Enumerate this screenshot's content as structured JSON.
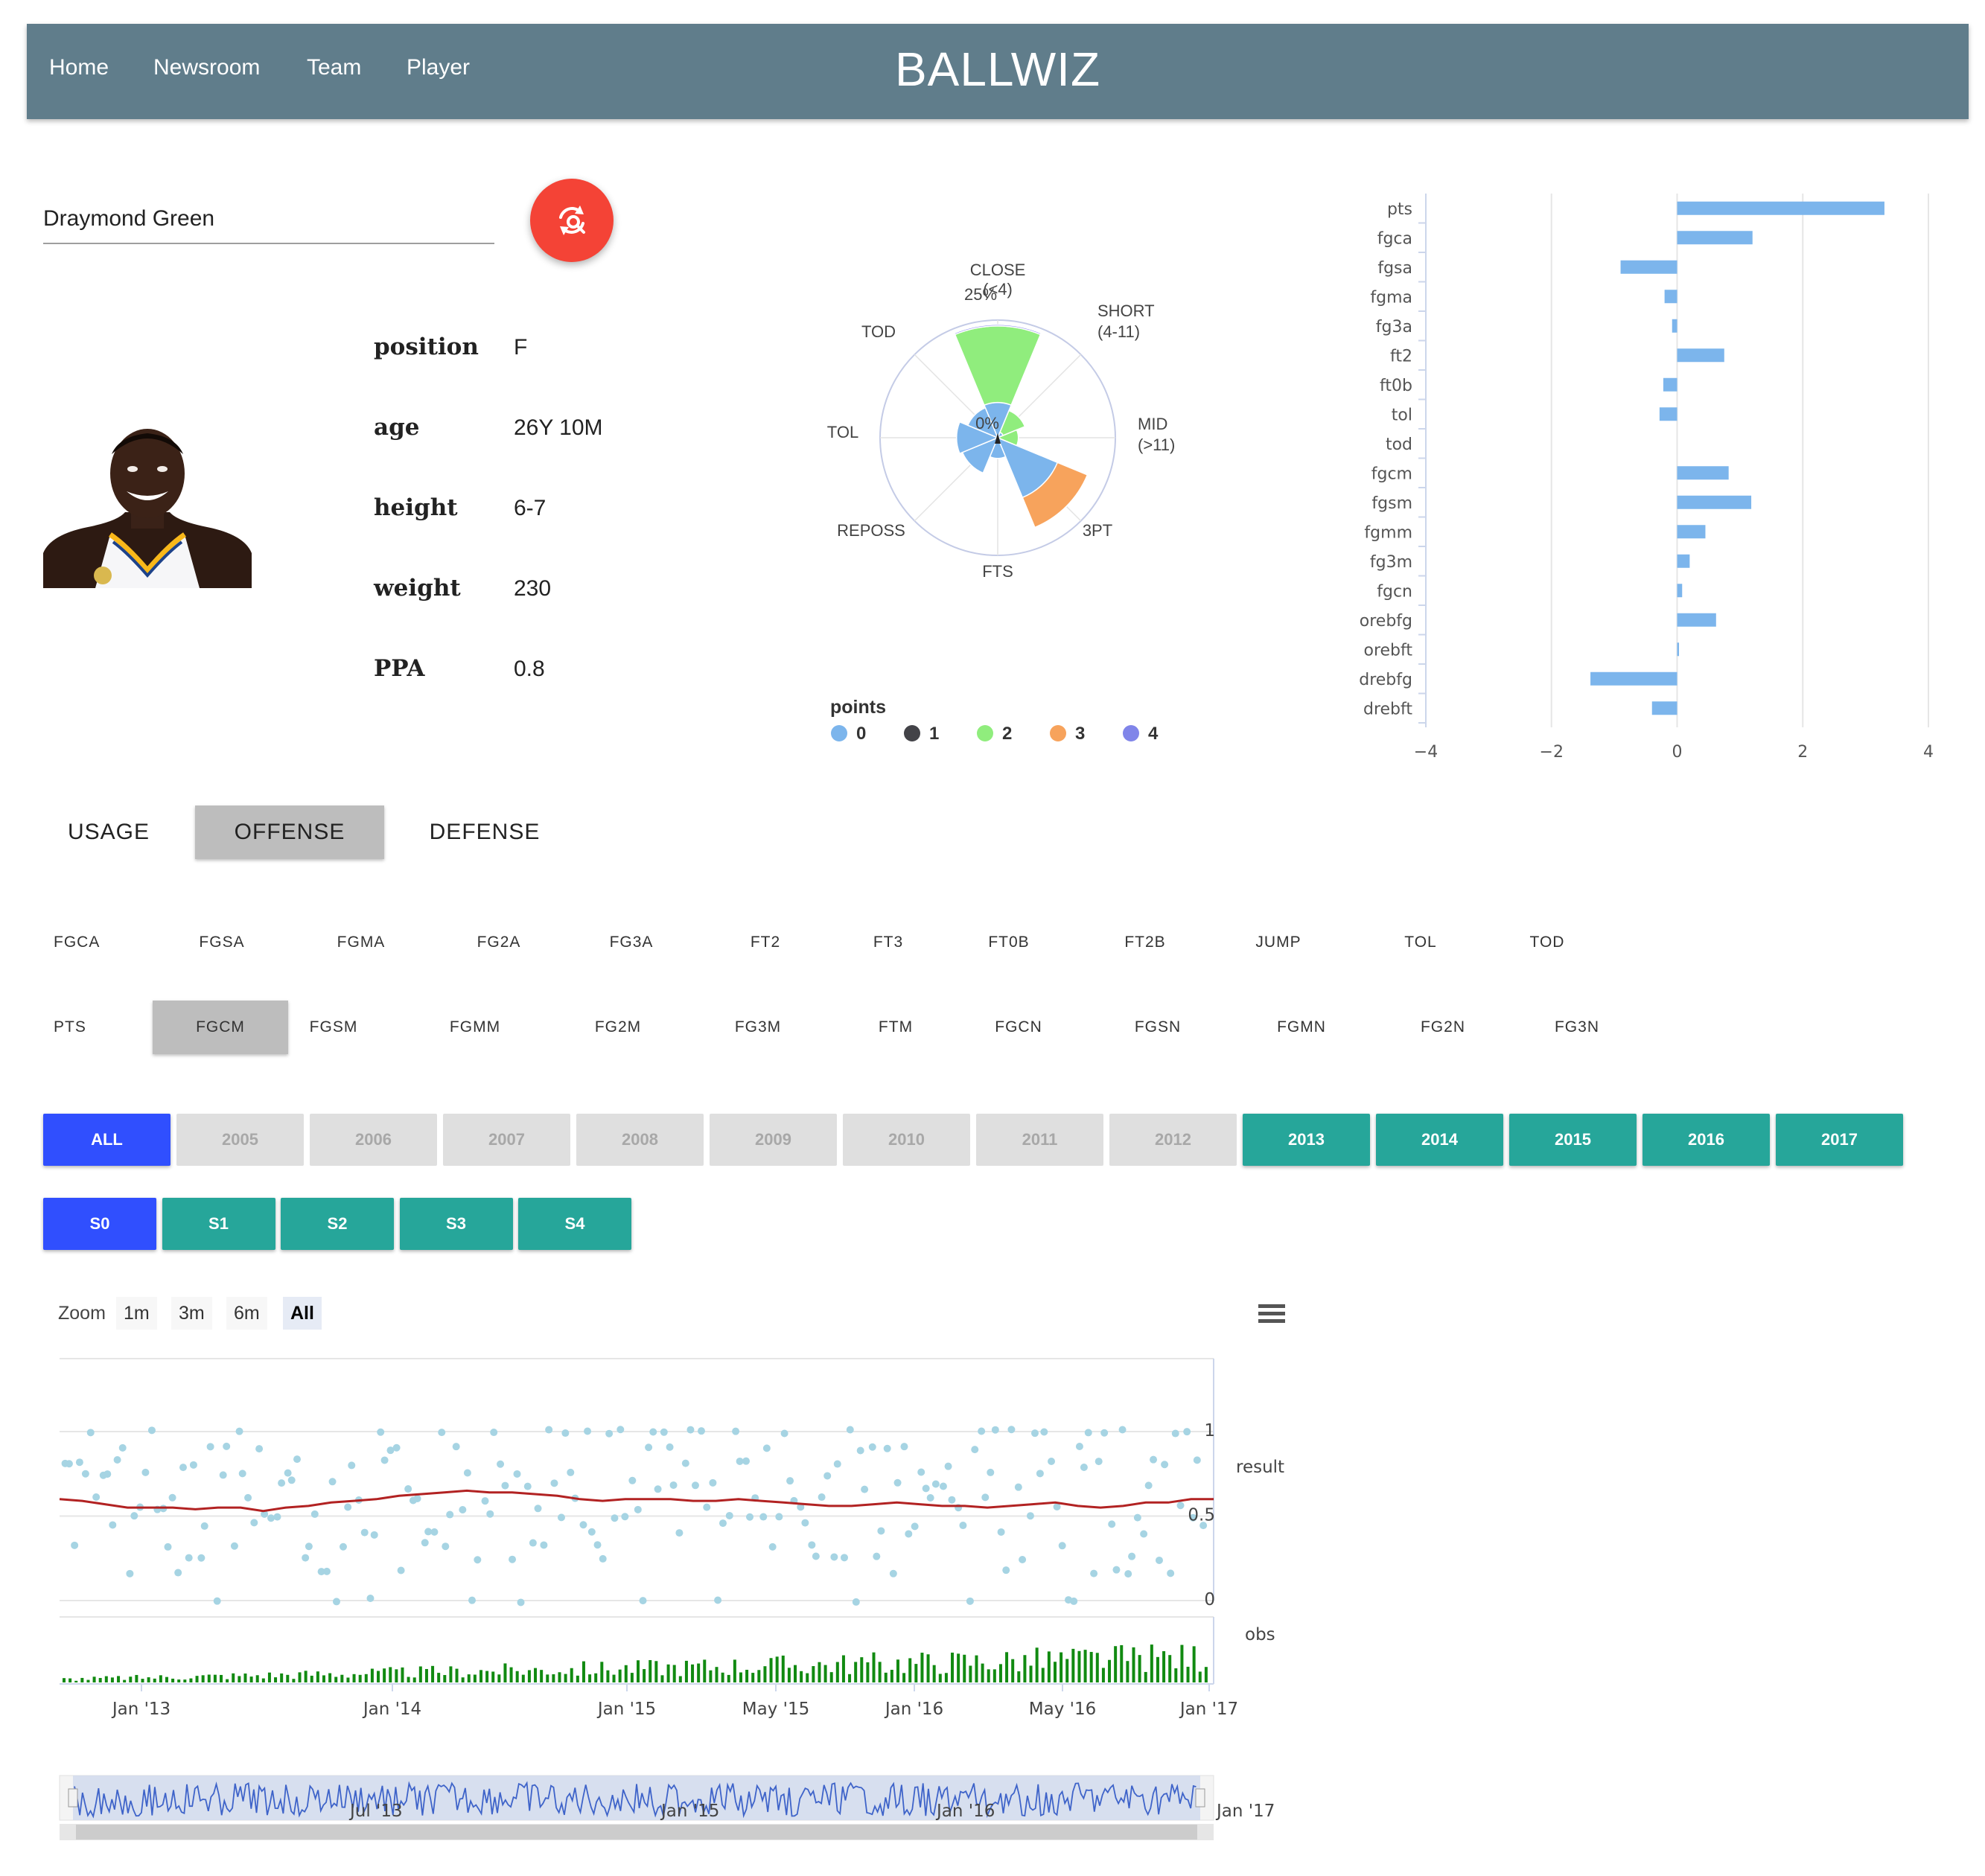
{
  "nav": {
    "brand": "BALLWIZ",
    "links": [
      "Home",
      "Newsroom",
      "Team",
      "Player"
    ]
  },
  "search": {
    "value": "Draymond Green"
  },
  "player": {
    "info": [
      {
        "key": "position",
        "value": "F"
      },
      {
        "key": "age",
        "value": "26Y 10M"
      },
      {
        "key": "height",
        "value": "6-7"
      },
      {
        "key": "weight",
        "value": "230"
      },
      {
        "key": "PPA",
        "value": "0.8"
      }
    ]
  },
  "polar": {
    "labels": [
      "CLOSE (<4)",
      "SHORT (4-11)",
      "MID (>11)",
      "3PT",
      "FTS",
      "REPOSS",
      "TOL",
      "TOD"
    ],
    "ring_labels": [
      "25%",
      "0%"
    ],
    "legend_title": "points",
    "legend": [
      {
        "label": "0",
        "color": "#7cb5ec"
      },
      {
        "label": "1",
        "color": "#434348"
      },
      {
        "label": "2",
        "color": "#90ed7d"
      },
      {
        "label": "3",
        "color": "#f7a35c"
      },
      {
        "label": "4",
        "color": "#8085e9"
      }
    ],
    "series": {
      "0": [
        0.12,
        0.02,
        0.0,
        0.22,
        0.07,
        0.13,
        0.14,
        0.11
      ],
      "1": [
        0.0,
        0.0,
        0.0,
        0.0,
        0.0,
        0.0,
        0.0,
        0.0
      ],
      "2": [
        0.26,
        0.08,
        0.07,
        0.0,
        0.0,
        0.0,
        0.0,
        0.0
      ],
      "3": [
        0.0,
        0.0,
        0.0,
        0.11,
        0.0,
        0.0,
        0.0,
        0.0
      ],
      "4": [
        0.005,
        0.0,
        0.0,
        0.0,
        0.0,
        0.0,
        0.0,
        0.0
      ]
    }
  },
  "bars": {
    "categories": [
      "pts",
      "fgca",
      "fgsa",
      "fgma",
      "fg3a",
      "ft2",
      "ft0b",
      "tol",
      "tod",
      "fgcm",
      "fgsm",
      "fgmm",
      "fg3m",
      "fgcn",
      "orebfg",
      "orebft",
      "drebfg",
      "drebft"
    ],
    "values": [
      3.3,
      1.2,
      -0.9,
      -0.2,
      -0.08,
      0.75,
      -0.22,
      -0.28,
      0.0,
      0.82,
      1.18,
      0.45,
      0.2,
      0.08,
      0.62,
      0.03,
      -1.38,
      -0.4
    ],
    "xlim": [
      -4,
      4
    ],
    "ticks": [
      "−4",
      "−2",
      "0",
      "2",
      "4"
    ],
    "color": "#7cb5ec"
  },
  "tabs": [
    "USAGE",
    "OFFENSE",
    "DEFENSE"
  ],
  "stats_row1": [
    "FGCA",
    "FGSA",
    "FGMA",
    "FG2A",
    "FG3A",
    "FT2",
    "FT3",
    "FT0B",
    "FT2B",
    "JUMP",
    "TOL",
    "TOD"
  ],
  "stats_row2": [
    "PTS",
    "FGCM",
    "FGSM",
    "FGMM",
    "FG2M",
    "FG3M",
    "FTM",
    "FGCN",
    "FGSN",
    "FGMN",
    "FG2N",
    "FG3N"
  ],
  "years": [
    {
      "label": "ALL",
      "state": "sel"
    },
    {
      "label": "2005",
      "state": "off"
    },
    {
      "label": "2006",
      "state": "off"
    },
    {
      "label": "2007",
      "state": "off"
    },
    {
      "label": "2008",
      "state": "off"
    },
    {
      "label": "2009",
      "state": "off"
    },
    {
      "label": "2010",
      "state": "off"
    },
    {
      "label": "2011",
      "state": "off"
    },
    {
      "label": "2012",
      "state": "off"
    },
    {
      "label": "2013",
      "state": "on"
    },
    {
      "label": "2014",
      "state": "on"
    },
    {
      "label": "2015",
      "state": "on"
    },
    {
      "label": "2016",
      "state": "on"
    },
    {
      "label": "2017",
      "state": "on"
    }
  ],
  "seasons": [
    {
      "label": "S0",
      "state": "sel"
    },
    {
      "label": "S1",
      "state": "on"
    },
    {
      "label": "S2",
      "state": "on"
    },
    {
      "label": "S3",
      "state": "on"
    },
    {
      "label": "S4",
      "state": "on"
    }
  ],
  "timeseries": {
    "zoom_label": "Zoom",
    "zoom_options": [
      "1m",
      "3m",
      "6m",
      "All"
    ],
    "zoom_selected": "All",
    "result_label": "result",
    "obs_label": "obs",
    "result_ticks": [
      "1",
      "0.5",
      "0"
    ],
    "x_ticks": [
      "Jan '13",
      "Jan '14",
      "Jan '15",
      "May '15",
      "Jan '16",
      "May '16",
      "Jan '17"
    ],
    "navigator_ticks": [
      "Jul '13",
      "Jan '15",
      "Jan '16",
      "Jan '17"
    ],
    "colors": {
      "points": "#a6d4e3",
      "trend": "#b22222",
      "obs": "#118a11",
      "navigator": "#3e63c9"
    }
  }
}
